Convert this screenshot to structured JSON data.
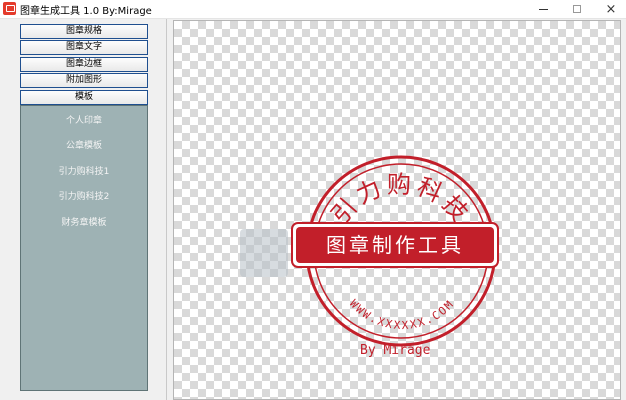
{
  "window": {
    "title": "图章生成工具 1.0    By:Mirage",
    "minimize_label": "",
    "close_label": "×"
  },
  "menu": {
    "items": [
      {
        "label": "图章规格"
      },
      {
        "label": "图章文字"
      },
      {
        "label": "图章边框"
      },
      {
        "label": "附加图形"
      },
      {
        "label": "模板"
      }
    ]
  },
  "templates": {
    "items": [
      {
        "label": "个人印章"
      },
      {
        "label": "公章模板"
      },
      {
        "label": "引力购科技1"
      },
      {
        "label": "引力购科技2"
      },
      {
        "label": "财务章模板"
      }
    ]
  },
  "stamp": {
    "arc_text": "引力购科技",
    "banner_text": "图章制作工具",
    "bottom_text": "WWW.XXXXXX.COM",
    "byline": "By Mirage",
    "color": "#c21f2a"
  },
  "colors": {
    "accent": "#c21f2a",
    "template_panel": "#9eb2b4",
    "button_border": "#1f4f8f"
  }
}
